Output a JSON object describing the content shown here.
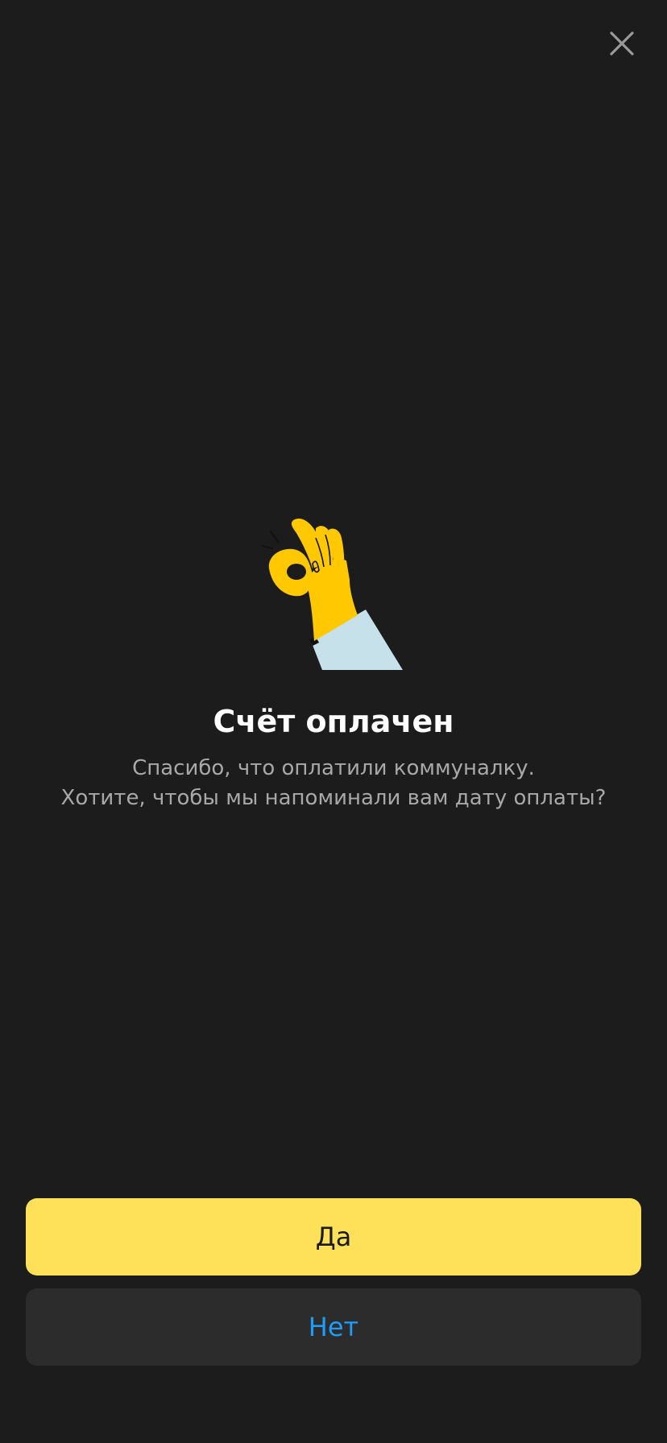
{
  "header": {
    "close_icon": "close-icon"
  },
  "illustration": {
    "icon": "ok-hand-icon",
    "colors": {
      "hand": "#ffc800",
      "sleeve": "#c7e1ea",
      "outline": "#111111"
    }
  },
  "main": {
    "title": "Счёт оплачен",
    "subtitle_line1": "Спасибо, что оплатили коммуналку.",
    "subtitle_line2": "Хотите, чтобы мы напоминали вам дату оплаты?"
  },
  "actions": {
    "yes_label": "Да",
    "no_label": "Нет"
  },
  "colors": {
    "background": "#1c1c1c",
    "primary_button": "#ffe159",
    "secondary_button": "#2c2c2c",
    "link_blue": "#1f9dff"
  }
}
